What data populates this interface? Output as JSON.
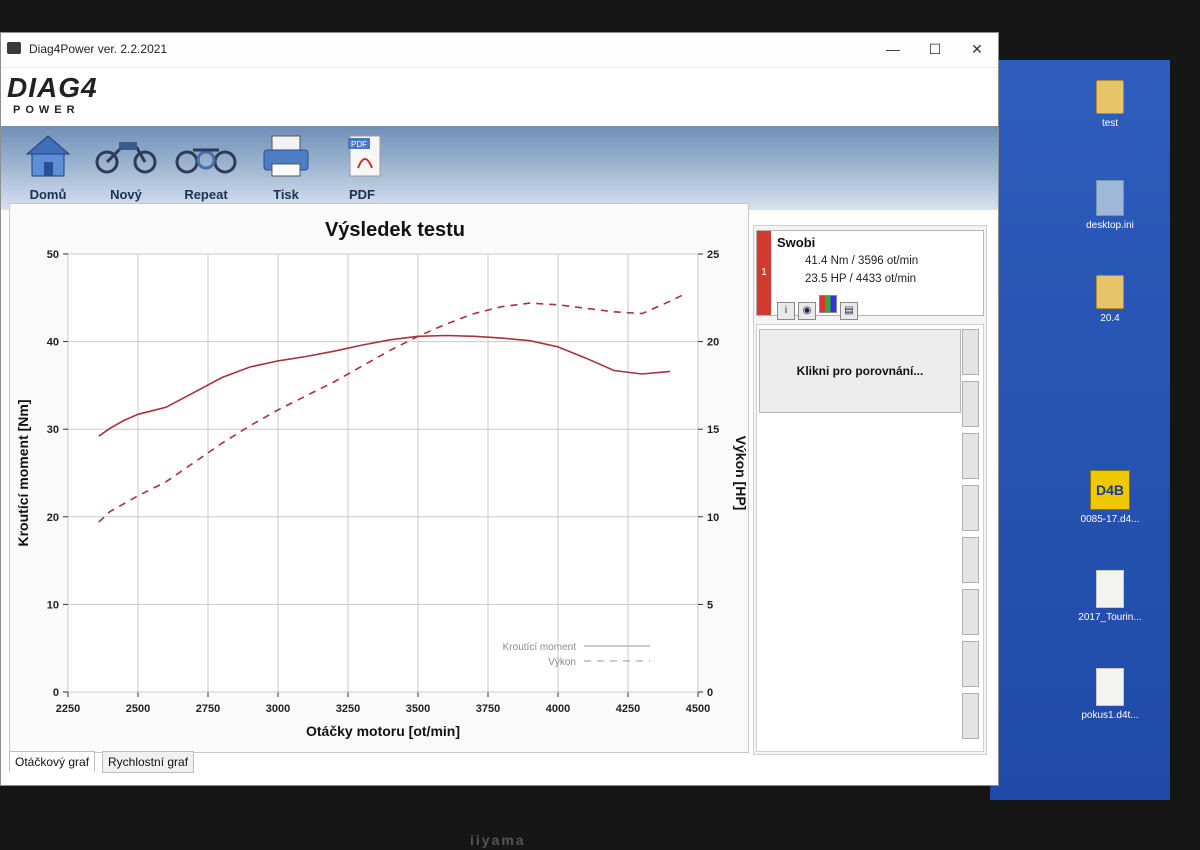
{
  "window": {
    "title": "Diag4Power ver. 2.2.2021",
    "min": "—",
    "max": "☐",
    "close": "✕"
  },
  "logo": {
    "main": "DIAG4",
    "sub": "POWER"
  },
  "toolbar": [
    {
      "label": "Domů",
      "icon": "home-icon"
    },
    {
      "label": "Nový",
      "icon": "new-bike-icon"
    },
    {
      "label": "Repeat",
      "icon": "repeat-bike-icon"
    },
    {
      "label": "Tisk",
      "icon": "printer-icon"
    },
    {
      "label": "PDF",
      "icon": "pdf-icon"
    }
  ],
  "tabs": [
    {
      "label": "Otáčkový graf",
      "active": true
    },
    {
      "label": "Rychlostní graf",
      "active": false
    }
  ],
  "result": {
    "index": "1",
    "name": "Swobi",
    "torque_line": "41.4 Nm / 3596 ot/min",
    "power_line": "23.5 HP / 4433 ot/min",
    "icons": [
      "info-icon",
      "eye-icon",
      "color-icon",
      "save-icon"
    ],
    "color": "#d23a2f"
  },
  "compare": {
    "label": "Klikni pro porovnání..."
  },
  "desktop": [
    {
      "label": "test",
      "type": "folder"
    },
    {
      "label": "desktop.ini",
      "type": "gearfile"
    },
    {
      "label": "20.4",
      "type": "folder"
    },
    {
      "label": "0085-17.d4...",
      "type": "d4b"
    },
    {
      "label": "2017_Tourin...",
      "type": "file"
    },
    {
      "label": "pokus1.d4t...",
      "type": "file"
    }
  ],
  "monitor_brand": "iiyama",
  "chart_data": {
    "type": "line",
    "title": "Výsledek testu",
    "xlabel": "Otáčky motoru [ot/min]",
    "ylabel": "Kroutící moment [Nm]",
    "y2label": "Výkon [HP]",
    "xlim": [
      2250,
      4500
    ],
    "ylim": [
      0,
      50
    ],
    "y2lim": [
      0,
      25
    ],
    "xticks": [
      2250,
      2500,
      2750,
      3000,
      3250,
      3500,
      3750,
      4000,
      4250,
      4500
    ],
    "yticks": [
      0,
      10,
      20,
      30,
      40,
      50
    ],
    "y2ticks": [
      0,
      5,
      10,
      15,
      20,
      25
    ],
    "grid": true,
    "legend_position": "bottom-right",
    "series": [
      {
        "name": "Kroutící moment",
        "axis": "left",
        "style": "solid",
        "color": "#a8323c",
        "x": [
          2360,
          2400,
          2450,
          2500,
          2550,
          2600,
          2700,
          2800,
          2900,
          3000,
          3100,
          3200,
          3300,
          3400,
          3500,
          3600,
          3700,
          3800,
          3900,
          4000,
          4100,
          4200,
          4300,
          4400
        ],
        "y": [
          29.2,
          30.1,
          31.0,
          31.7,
          32.1,
          32.5,
          34.2,
          35.9,
          37.1,
          37.8,
          38.3,
          38.9,
          39.6,
          40.2,
          40.6,
          40.7,
          40.6,
          40.4,
          40.1,
          39.4,
          38.1,
          36.7,
          36.3,
          36.6
        ]
      },
      {
        "name": "Výkon",
        "axis": "right",
        "style": "dashed",
        "color": "#a8323c",
        "x": [
          2360,
          2400,
          2500,
          2600,
          2700,
          2800,
          2900,
          3000,
          3100,
          3200,
          3300,
          3400,
          3500,
          3600,
          3700,
          3800,
          3900,
          4000,
          4100,
          4200,
          4300,
          4400,
          4450
        ],
        "y": [
          9.7,
          10.3,
          11.2,
          12.0,
          13.1,
          14.2,
          15.2,
          16.1,
          16.9,
          17.7,
          18.6,
          19.5,
          20.3,
          21.0,
          21.6,
          22.0,
          22.2,
          22.1,
          21.9,
          21.7,
          21.6,
          22.3,
          22.7
        ]
      }
    ]
  }
}
